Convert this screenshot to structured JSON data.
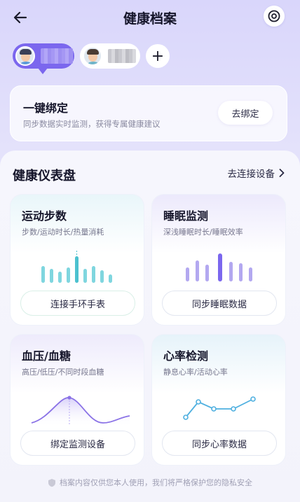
{
  "header": {
    "title": "健康档案"
  },
  "profiles": {
    "add_symbol": "+"
  },
  "bind_card": {
    "title": "一键绑定",
    "subtitle": "同步数据实时监测，获得专属健康建议",
    "button_label": "去绑定"
  },
  "dashboard": {
    "title": "健康仪表盘",
    "link_label": "去连接设备",
    "cards": [
      {
        "title": "运动步数",
        "subtitle": "步数/运动时长/热量消耗",
        "button_label": "连接手环手表",
        "accent": "#5cc8d6"
      },
      {
        "title": "睡眠监测",
        "subtitle": "深浅睡眠时长/睡眠效率",
        "button_label": "同步睡眠数据",
        "accent": "#8b7cec"
      },
      {
        "title": "血压/血糖",
        "subtitle": "高压/低压/不同时段血糖",
        "button_label": "绑定监测设备",
        "accent": "#8a72e6"
      },
      {
        "title": "心率检测",
        "subtitle": "静息心率/活动心率",
        "button_label": "同步心率数据",
        "accent": "#4fb0e0"
      }
    ]
  },
  "footer": {
    "text": "档案内容仅供您本人使用，我们将严格保护您的隐私安全"
  },
  "colors": {
    "primary": "#7b67ee",
    "background": "#e4e2fb"
  }
}
